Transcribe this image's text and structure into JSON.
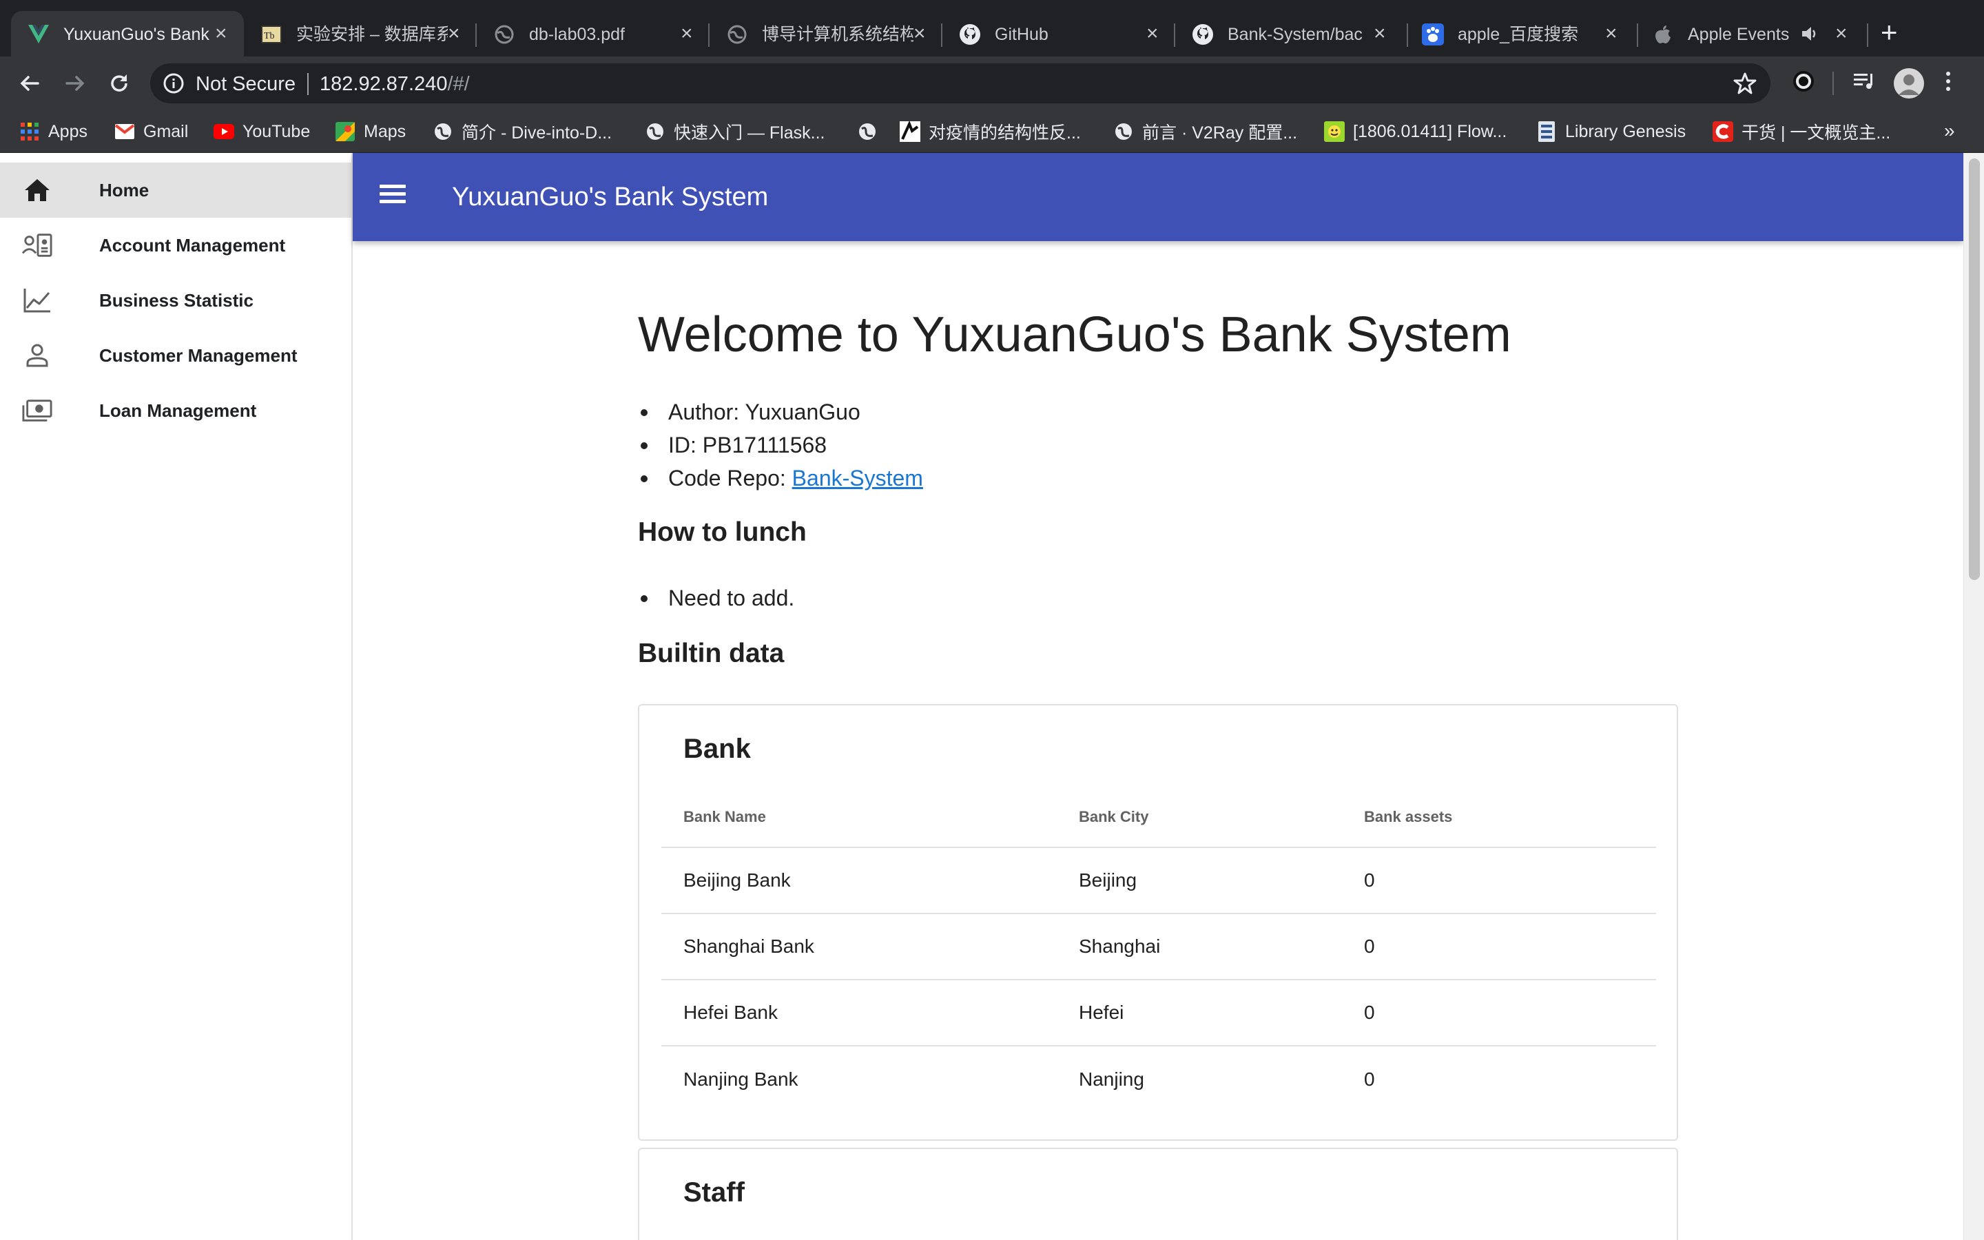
{
  "browser": {
    "tabs": [
      {
        "title": "YuxuanGuo's Bank",
        "icon": "vue-logo-icon",
        "active": true
      },
      {
        "title": "实验安排 – 数据库系",
        "icon": "tb-site-icon",
        "active": false
      },
      {
        "title": "db-lab03.pdf",
        "icon": "globe-icon",
        "active": false
      },
      {
        "title": "博导计算机系统结构",
        "icon": "globe-icon",
        "active": false
      },
      {
        "title": "GitHub",
        "icon": "github-icon",
        "active": false
      },
      {
        "title": "Bank-System/bac",
        "icon": "github-icon",
        "active": false
      },
      {
        "title": "apple_百度搜索",
        "icon": "baidu-paw-icon",
        "active": false
      },
      {
        "title": "Apple Events -",
        "icon": "apple-icon",
        "active": false
      }
    ],
    "security_label": "Not Secure",
    "url_host": "182.92.87.240",
    "url_path": "/#/",
    "bookmarks": [
      {
        "label": "Apps",
        "icon": "apps-grid-icon"
      },
      {
        "label": "Gmail",
        "icon": "gmail-icon"
      },
      {
        "label": "YouTube",
        "icon": "youtube-icon"
      },
      {
        "label": "Maps",
        "icon": "maps-icon"
      },
      {
        "label": "简介 - Dive-into-D...",
        "icon": "globe-icon"
      },
      {
        "label": "快速入门 — Flask...",
        "icon": "globe-icon"
      },
      {
        "label": "",
        "icon": "globe-icon"
      },
      {
        "label": "对疫情的结构性反...",
        "icon": "bookmark-site-icon"
      },
      {
        "label": "前言 · V2Ray 配置...",
        "icon": "globe-icon"
      },
      {
        "label": "[1806.01411] Flow...",
        "icon": "arxiv-icon"
      },
      {
        "label": "Library Genesis",
        "icon": "libgen-icon"
      },
      {
        "label": "干货 | 一文概览主...",
        "icon": "csdn-icon"
      }
    ],
    "bookmarks_more": "»"
  },
  "sidebar": {
    "items": [
      {
        "label": "Home",
        "icon": "home-icon",
        "active": true
      },
      {
        "label": "Account Management",
        "icon": "account-card-icon",
        "active": false
      },
      {
        "label": "Business Statistic",
        "icon": "line-chart-icon",
        "active": false
      },
      {
        "label": "Customer Management",
        "icon": "person-icon",
        "active": false
      },
      {
        "label": "Loan Management",
        "icon": "cash-icon",
        "active": false
      }
    ]
  },
  "appbar": {
    "title": "YuxuanGuo's Bank System",
    "color": "#3f51b5"
  },
  "main": {
    "heading": "Welcome to YuxuanGuo's Bank System",
    "info": {
      "author": "Author: YuxuanGuo",
      "id": "ID: PB17111568",
      "repo_prefix": "Code Repo: ",
      "repo_link": "Bank-System"
    },
    "how_to_heading": "How to lunch",
    "how_to_items": [
      "Need to add."
    ],
    "builtin_heading": "Builtin data",
    "bank_card": {
      "title": "Bank",
      "columns": [
        "Bank Name",
        "Bank City",
        "Bank assets"
      ],
      "rows": [
        [
          "Beijing Bank",
          "Beijing",
          "0"
        ],
        [
          "Shanghai Bank",
          "Shanghai",
          "0"
        ],
        [
          "Hefei Bank",
          "Hefei",
          "0"
        ],
        [
          "Nanjing Bank",
          "Nanjing",
          "0"
        ]
      ]
    },
    "staff_card": {
      "title": "Staff"
    }
  }
}
